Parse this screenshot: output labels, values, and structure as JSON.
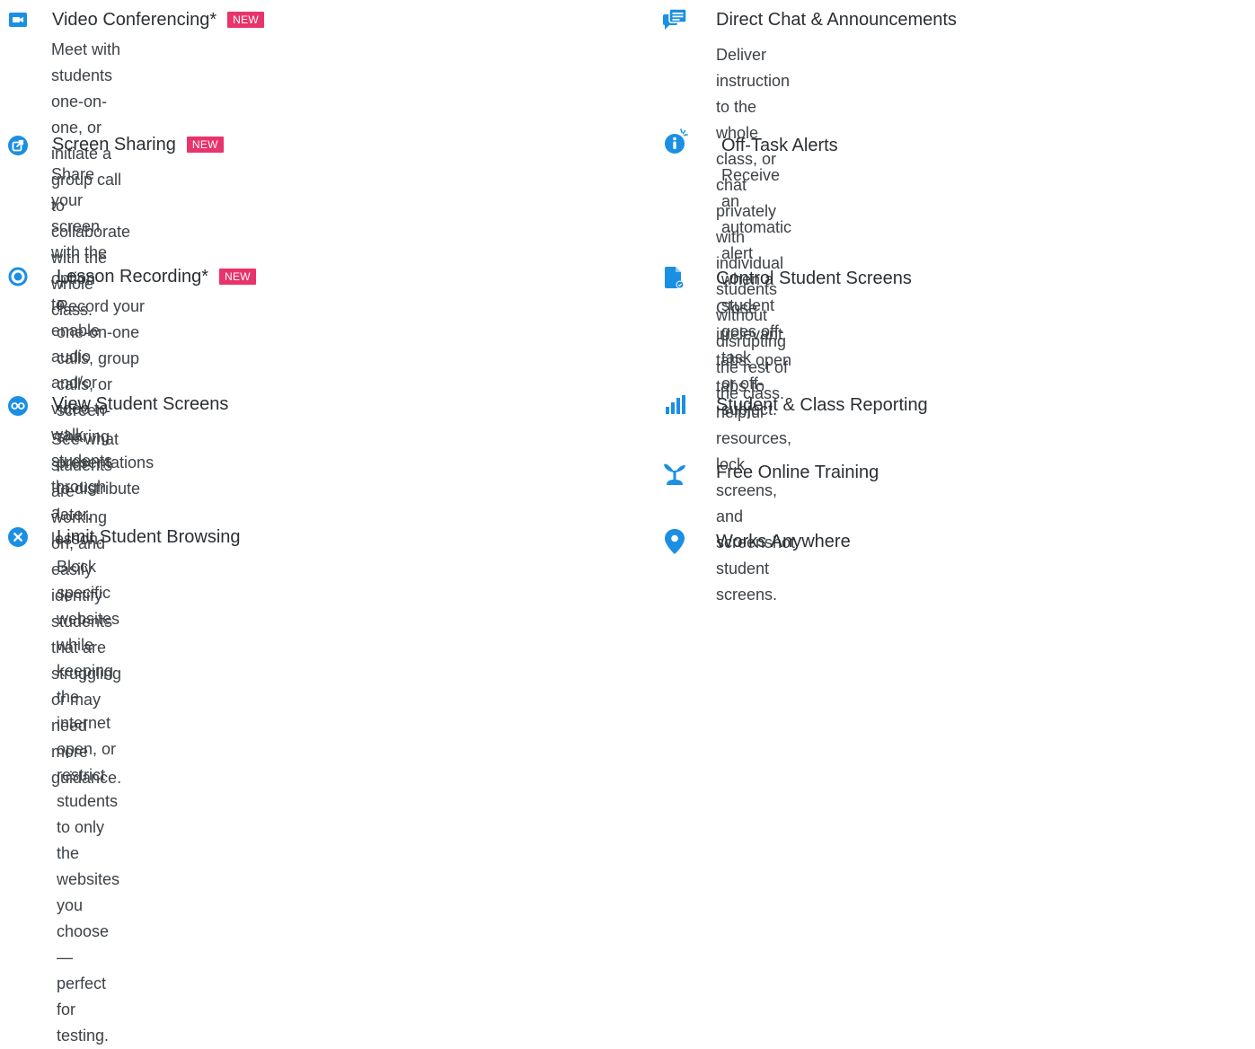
{
  "colors": {
    "accent": "#1a8fe3",
    "badge": "#e8336b",
    "text": "#2b2f33"
  },
  "left": [
    {
      "id": "video",
      "icon": "video-camera-icon",
      "title": "Video Conferencing*",
      "badge": "NEW",
      "desc": [
        "Meet with students one-on-one, or initiate a group call to",
        "collaborate with the whole class."
      ]
    },
    {
      "id": "screen",
      "icon": "share-screen-icon",
      "title": "Screen Sharing",
      "badge": "NEW",
      "desc": [
        "Share your screen with the option to enable audio and/or",
        "video to walk students through a lesson."
      ]
    },
    {
      "id": "record",
      "icon": "record-icon",
      "title": "Lesson Recording*",
      "badge": "NEW",
      "desc": [
        "Record your one-on-one calls, group calls, or",
        "screen-sharing presentations to distribute later."
      ]
    },
    {
      "id": "view",
      "icon": "eye-icon",
      "title": "View Student Screens",
      "badge": "",
      "desc": [
        "See what students are working on, and easily identify",
        "students that are struggling or may need more guidance."
      ]
    },
    {
      "id": "limit",
      "icon": "block-icon",
      "title": "Limit Student Browsing",
      "badge": "",
      "desc": [
        "Block specific websites while keeping the internet open, or",
        "restrict students to only the websites you choose—perfect",
        "for testing."
      ]
    }
  ],
  "right": [
    {
      "id": "chat",
      "icon": "chat-icon",
      "title": "Direct Chat & Announcements",
      "badge": "",
      "desc": [
        "Deliver instruction to the whole class, or chat privately with",
        "individual students without disrupting the rest of the class."
      ]
    },
    {
      "id": "alerts",
      "icon": "alert-info-icon",
      "title": "Off-Task Alerts",
      "badge": "",
      "desc": [
        "Receive an automatic alert when a student goes off-task",
        "or off-subject."
      ]
    },
    {
      "id": "control",
      "icon": "document-check-icon",
      "title": "Control Student Screens",
      "badge": "",
      "desc": [
        "Close irrelevant tabs, open tabs to helpful resources,",
        "lock screens, and screenshot student screens."
      ]
    },
    {
      "id": "reporting",
      "icon": "bar-chart-icon",
      "title": "Student & Class Reporting",
      "badge": "",
      "desc": []
    },
    {
      "id": "training",
      "icon": "sprout-icon",
      "title": "Free Online Training",
      "badge": "",
      "desc": []
    },
    {
      "id": "anywhere",
      "icon": "map-pin-icon",
      "title": "Works Anywhere",
      "badge": "",
      "desc": []
    }
  ]
}
